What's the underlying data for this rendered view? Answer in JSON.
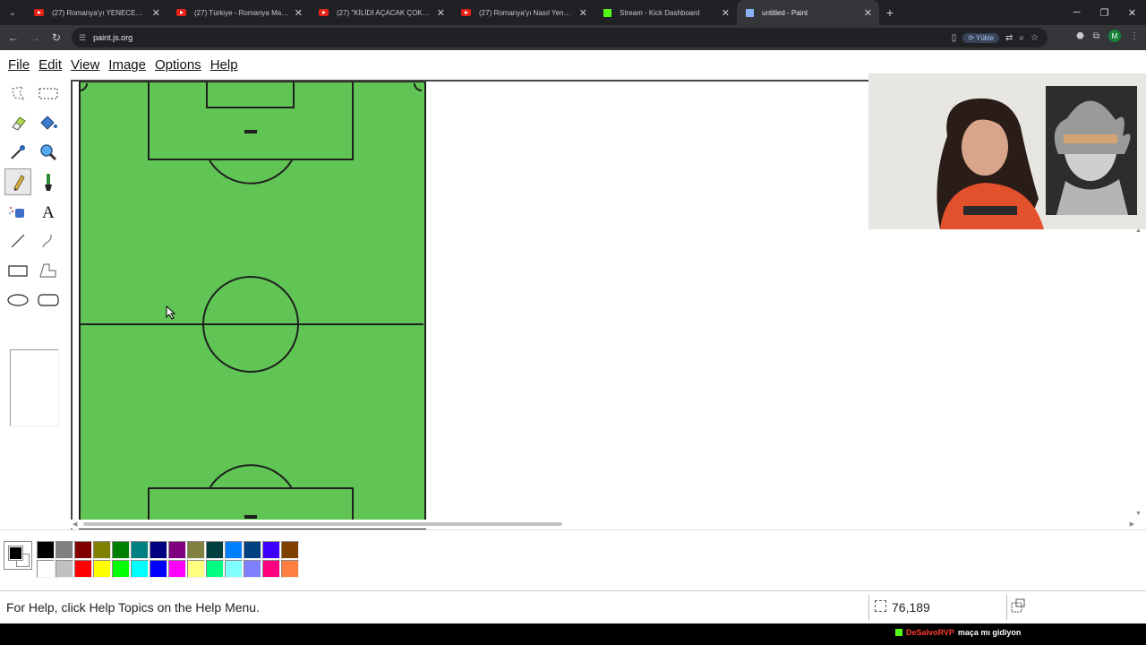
{
  "browser": {
    "tabs": [
      {
        "title": "(27) Romanya'yı YENECEK 11'i ...",
        "icon": "youtube-icon"
      },
      {
        "title": "(27) Türkiye - Romanya Maç Ön...",
        "icon": "youtube-icon"
      },
      {
        "title": "(27) \"KİLİDİ AÇACAK ÇOK FAZL...",
        "icon": "youtube-icon"
      },
      {
        "title": "(27) Romanya'yı Nasıl Yeneriz? ...",
        "icon": "youtube-icon"
      },
      {
        "title": "Stream - Kick Dashboard",
        "icon": "kick-icon"
      },
      {
        "title": "untitled - Paint",
        "icon": "paint-icon",
        "active": true
      }
    ],
    "url": "paint.js.org",
    "upload_label": "Yükle",
    "profile_initial": "M"
  },
  "paint": {
    "menu": [
      "File",
      "Edit",
      "View",
      "Image",
      "Options",
      "Help"
    ],
    "status_help": "For Help, click Help Topics on the Help Menu.",
    "coordinates": "76,189",
    "palette": {
      "foreground": "#000000",
      "background": "#ffffff",
      "row1": [
        "#000000",
        "#808080",
        "#800000",
        "#808000",
        "#008000",
        "#008080",
        "#000080",
        "#800080",
        "#808040",
        "#004040",
        "#0080ff",
        "#004080",
        "#4000ff",
        "#804000"
      ],
      "row2": [
        "#ffffff",
        "#c0c0c0",
        "#ff0000",
        "#ffff00",
        "#00ff00",
        "#00ffff",
        "#0000ff",
        "#ff00ff",
        "#ffff80",
        "#00ff80",
        "#80ffff",
        "#8080ff",
        "#ff0080",
        "#ff8040"
      ]
    },
    "canvas_colors": {
      "field": "#60c554",
      "line": "#1f1f1f"
    }
  },
  "overlay": {
    "chat_user": "DeSalvoRVP",
    "chat_message": "maça mı gidiyon"
  }
}
